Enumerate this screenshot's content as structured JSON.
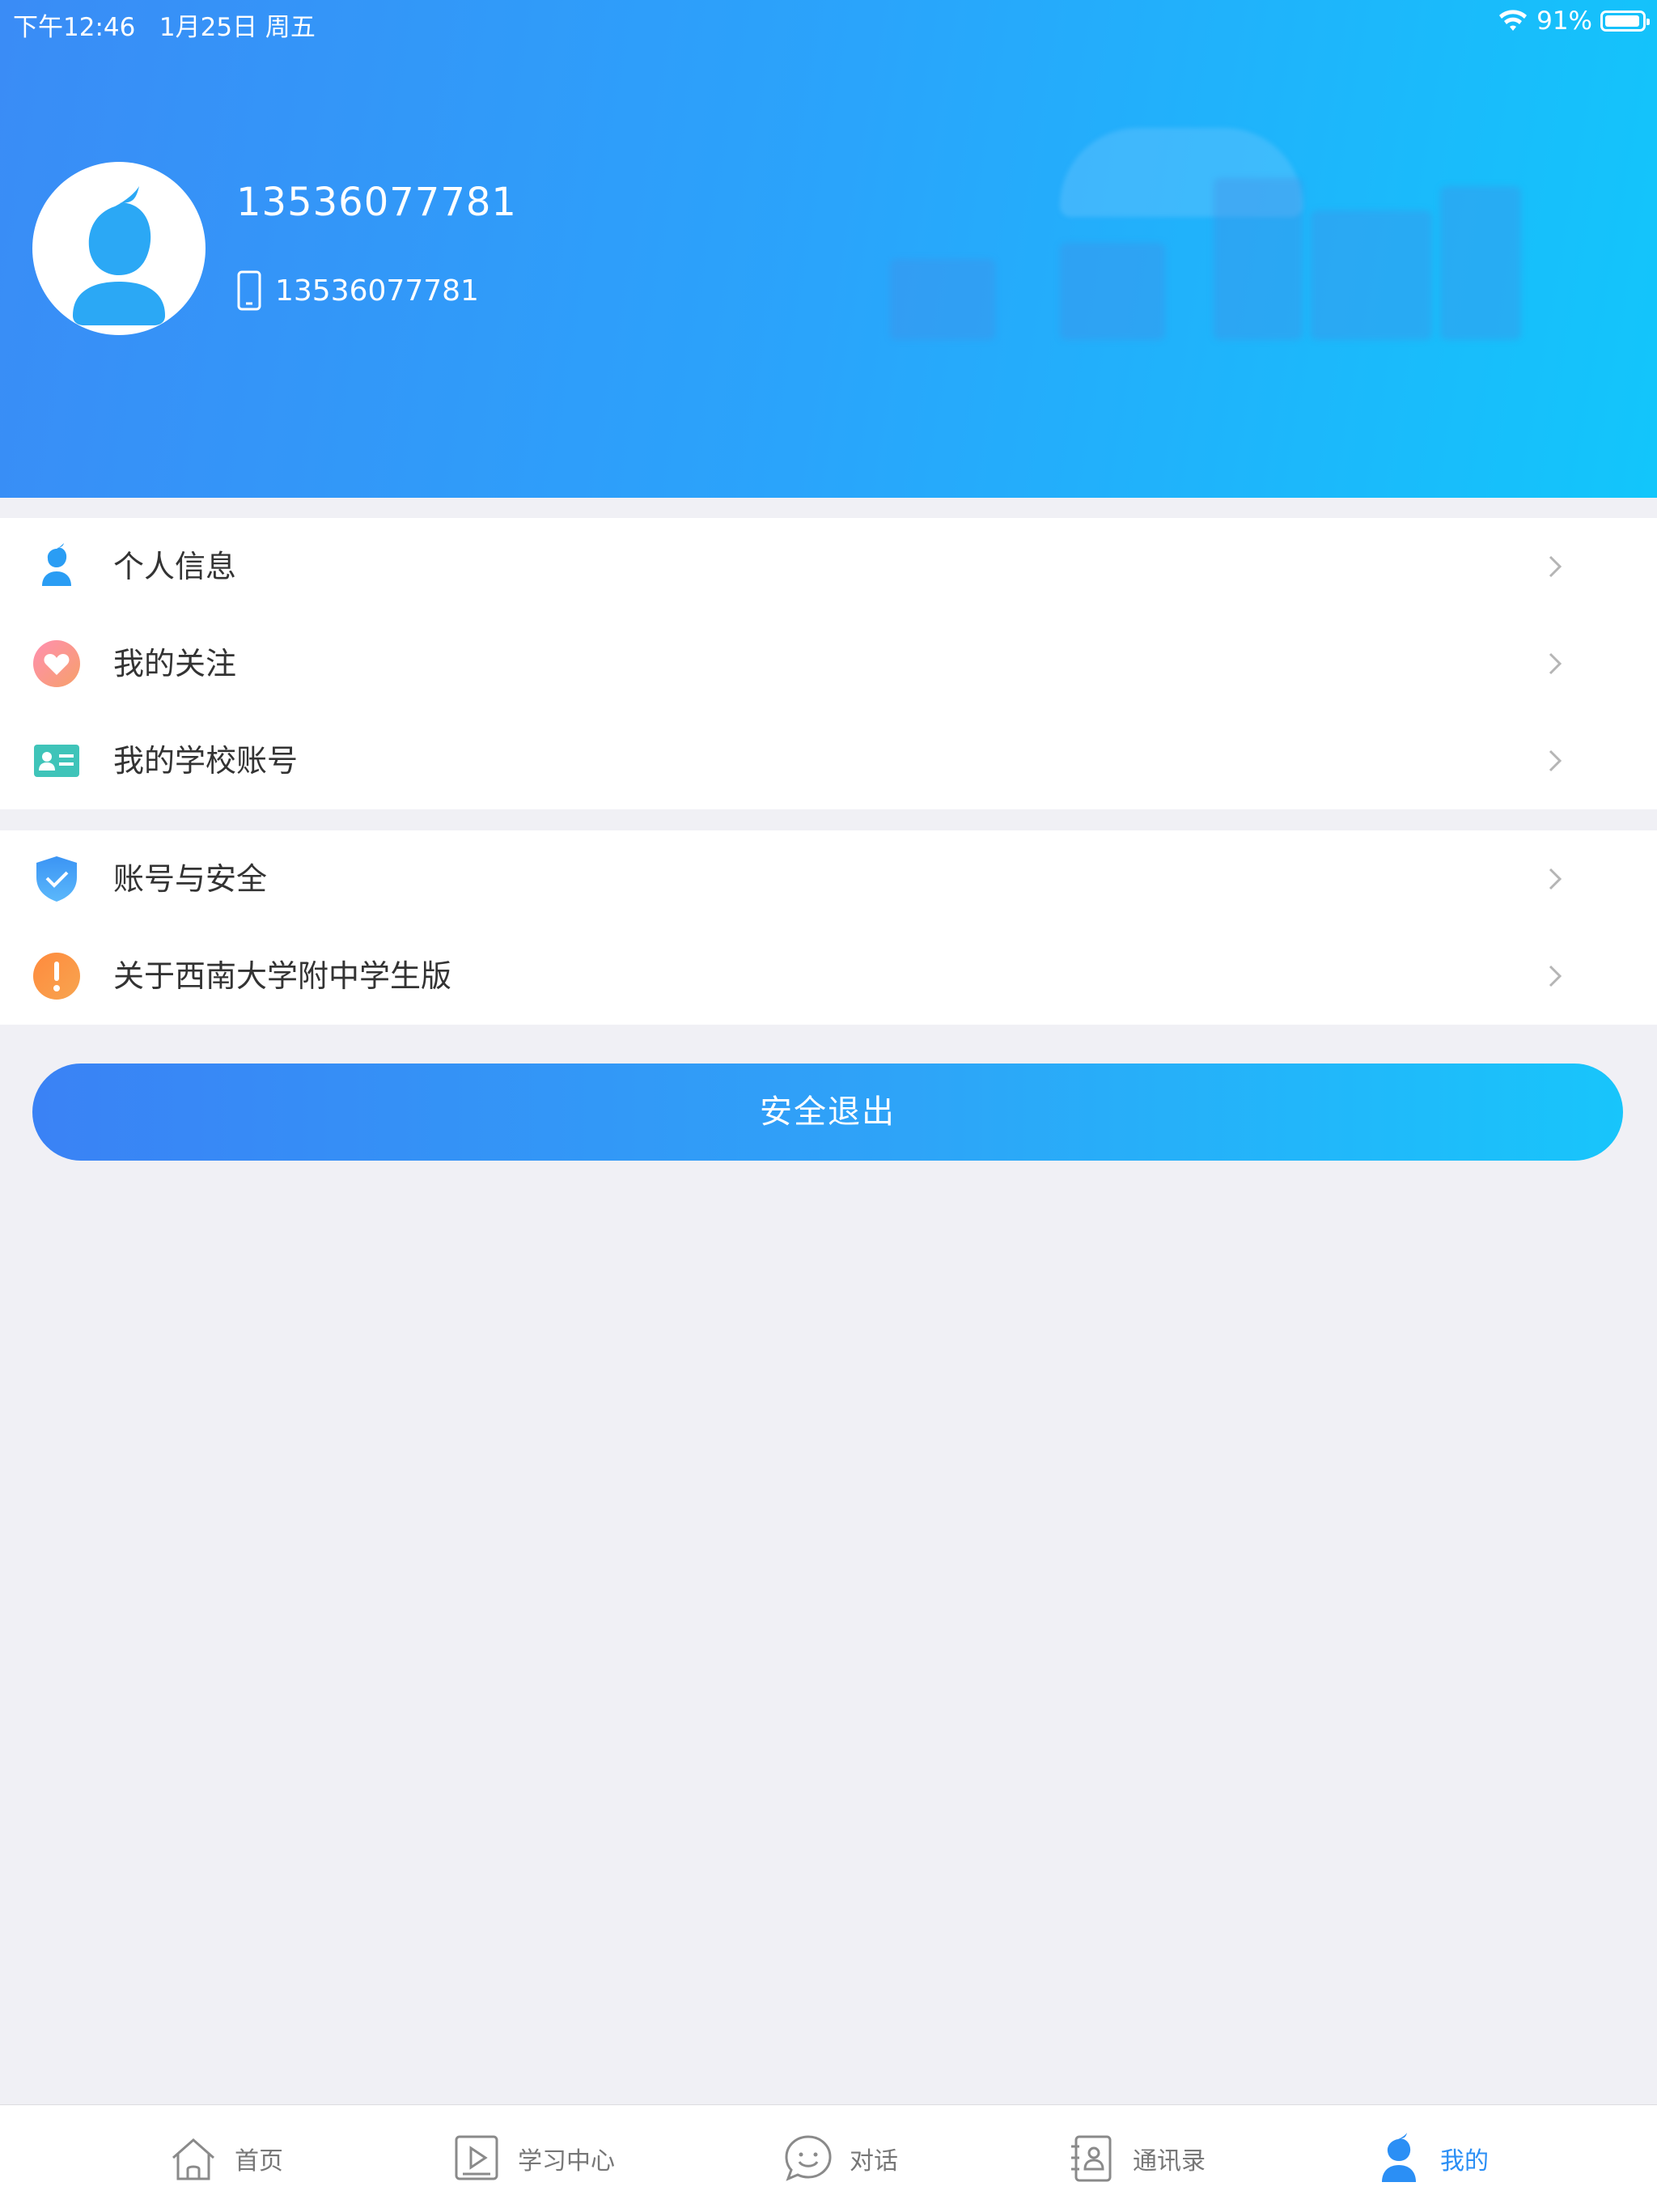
{
  "status_bar": {
    "time": "下午12:46",
    "date": "1月25日 周五",
    "battery": "91%"
  },
  "profile": {
    "name": "13536077781",
    "phone": "13536077781"
  },
  "menu_group_1": [
    {
      "label": "个人信息",
      "icon": "user-icon"
    },
    {
      "label": "我的关注",
      "icon": "heart-icon"
    },
    {
      "label": "我的学校账号",
      "icon": "id-card-icon"
    }
  ],
  "menu_group_2": [
    {
      "label": "账号与安全",
      "icon": "shield-icon"
    },
    {
      "label": "关于西南大学附中学生版",
      "icon": "info-icon"
    }
  ],
  "logout_label": "安全退出",
  "tabs": [
    {
      "label": "首页",
      "icon": "home-icon"
    },
    {
      "label": "学习中心",
      "icon": "play-icon"
    },
    {
      "label": "对话",
      "icon": "chat-icon"
    },
    {
      "label": "通讯录",
      "icon": "contacts-icon"
    },
    {
      "label": "我的",
      "icon": "profile-icon",
      "active": true
    }
  ],
  "colors": {
    "header_start": "#3a8cf6",
    "header_end": "#12c6fb",
    "accent": "#2b8ff5",
    "background": "#f0f0f5"
  }
}
